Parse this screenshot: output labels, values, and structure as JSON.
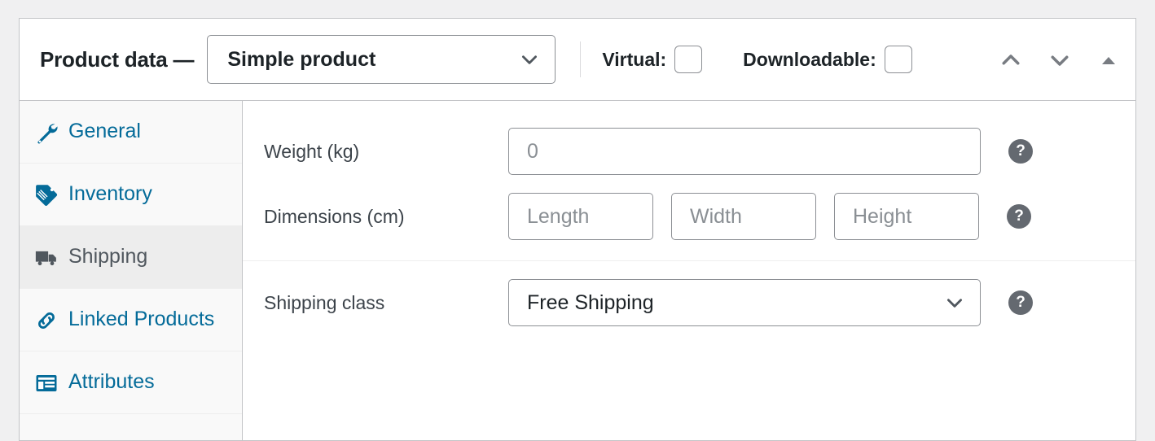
{
  "panel": {
    "header": {
      "title": "Product data —",
      "product_type": {
        "selected": "Simple product",
        "icon": "chevron-down-icon"
      },
      "virtual": {
        "label": "Virtual:",
        "checked": false
      },
      "downloadable": {
        "label": "Downloadable:",
        "checked": false
      },
      "controls": [
        {
          "name": "move-up-icon",
          "glyph": "chevron-up"
        },
        {
          "name": "move-down-icon",
          "glyph": "chevron-down"
        },
        {
          "name": "toggle-panel-icon",
          "glyph": "triangle-up"
        }
      ]
    },
    "tabs": [
      {
        "label": "General",
        "icon": "wrench-icon",
        "active": false
      },
      {
        "label": "Inventory",
        "icon": "tag-icon",
        "active": false
      },
      {
        "label": "Shipping",
        "icon": "truck-icon",
        "active": true
      },
      {
        "label": "Linked Products",
        "icon": "link-icon",
        "active": false
      },
      {
        "label": "Attributes",
        "icon": "attributes-icon",
        "active": false
      }
    ],
    "shipping_panel": {
      "weight": {
        "label": "Weight (kg)",
        "value": "",
        "placeholder": "0",
        "help": "?"
      },
      "dimensions": {
        "label": "Dimensions (cm)",
        "length_placeholder": "Length",
        "width_placeholder": "Width",
        "height_placeholder": "Height",
        "length_value": "",
        "width_value": "",
        "height_value": "",
        "help": "?"
      },
      "shipping_class": {
        "label": "Shipping class",
        "selected": "Free Shipping",
        "help": "?"
      }
    }
  },
  "colors": {
    "link_blue": "#046b99",
    "active_text": "#50575e",
    "border": "#c3c4c7",
    "field_border": "#8c8f94",
    "help_bg": "#646970"
  }
}
